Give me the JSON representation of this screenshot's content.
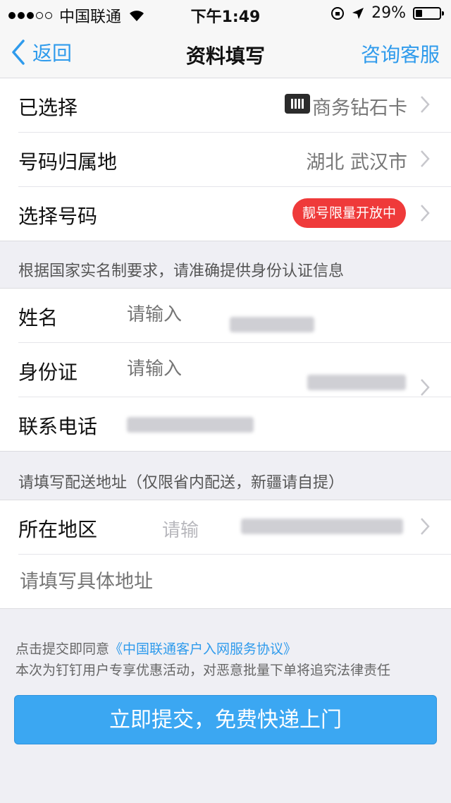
{
  "status_bar": {
    "carrier": "中国联通",
    "time": "下午1:49",
    "battery": "29%",
    "battery_level": 0.29
  },
  "nav": {
    "back": "返回",
    "title": "资料填写",
    "right": "咨询客服"
  },
  "group1": {
    "selected_label": "已选择",
    "selected_value": "商务钻石卡",
    "region_label": "号码归属地",
    "region_value": "湖北 武汉市",
    "number_label": "选择号码",
    "number_badge": "靓号限量开放中"
  },
  "note1": "根据国家实名制要求，请准确提供身份认证信息",
  "group2": {
    "name_label": "姓名",
    "name_placeholder": "请输入",
    "id_label": "身份证",
    "id_placeholder": "请输入",
    "phone_label": "联系电话"
  },
  "note2": "请填写配送地址（仅限省内配送，新疆请自提）",
  "group3": {
    "area_label": "所在地区",
    "area_placeholder": "请输",
    "address_placeholder": "请填写具体地址"
  },
  "agreement": {
    "prefix": "点击提交即同意",
    "link": "《中国联通客户入网服务协议》",
    "notice": "本次为钉钉用户专享优惠活动，对恶意批量下单将追究法律责任"
  },
  "submit": "立即提交，免费快递上门",
  "colors": {
    "accent": "#2f9bec",
    "badge": "#ef3a3a",
    "button": "#3ba7f2"
  }
}
